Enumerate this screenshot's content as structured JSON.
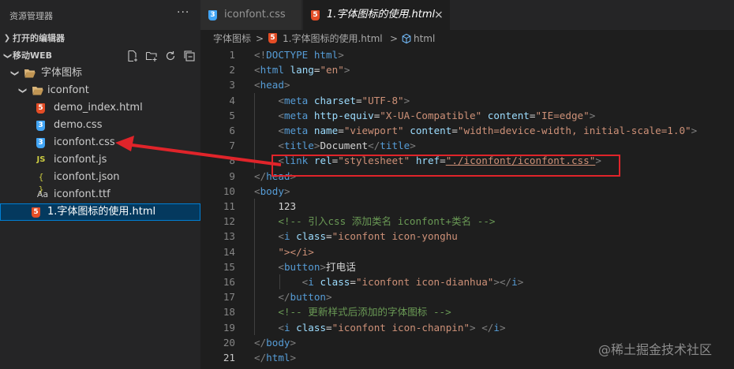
{
  "sidebar": {
    "title": "资源管理器",
    "more_icon": "ellipsis-icon",
    "open_editors_label": "打开的编辑器",
    "workspace_label": "移动WEB",
    "actions": [
      "new-file-icon",
      "new-folder-icon",
      "refresh-icon",
      "collapse-all-icon"
    ],
    "tree": [
      {
        "label": "字体图标",
        "type": "folder",
        "icon": "folder-open-icon"
      },
      {
        "label": "iconfont",
        "type": "folder",
        "icon": "folder-open-icon"
      },
      {
        "label": "demo_index.html",
        "type": "file",
        "icon": "html5-icon",
        "icon_text": "5"
      },
      {
        "label": "demo.css",
        "type": "file",
        "icon": "css3-icon",
        "icon_text": "3"
      },
      {
        "label": "iconfont.css",
        "type": "file",
        "icon": "css3-icon",
        "icon_text": "3"
      },
      {
        "label": "iconfont.js",
        "type": "file",
        "icon": "js-icon",
        "icon_text": "JS"
      },
      {
        "label": "iconfont.json",
        "type": "file",
        "icon": "json-braces-icon",
        "icon_text": "{ }"
      },
      {
        "label": "iconfont.ttf",
        "type": "file",
        "icon": "font-icon",
        "icon_text": "Aa"
      },
      {
        "label": "1.字体图标的使用.html",
        "type": "file",
        "icon": "html5-icon",
        "icon_text": "5",
        "selected": true
      }
    ]
  },
  "tabs": [
    {
      "label": "iconfont.css",
      "icon": "css3-icon",
      "active": false
    },
    {
      "label": "1.字体图标的使用.html",
      "icon": "html5-icon",
      "active": true,
      "close": "×"
    }
  ],
  "breadcrumb": {
    "folder": "字体图标",
    "sep": ">",
    "file": "1.字体图标的使用.html",
    "symbol": "html"
  },
  "editor": {
    "current_line": 21,
    "line_numbers": [
      "1",
      "2",
      "3",
      "4",
      "5",
      "6",
      "7",
      "8",
      "9",
      "10",
      "11",
      "12",
      "13",
      "14",
      "15",
      "16",
      "17",
      "18",
      "19",
      "20",
      "21"
    ],
    "lines": [
      "<!DOCTYPE html>",
      "<html lang=\"en\">",
      "<head>",
      "    <meta charset=\"UTF-8\">",
      "    <meta http-equiv=\"X-UA-Compatible\" content=\"IE=edge\">",
      "    <meta name=\"viewport\" content=\"width=device-width, initial-scale=1.0\">",
      "    <title>Document</title>",
      "    <link rel=\"stylesheet\" href=\"./iconfont/iconfont.css\">",
      "</head>",
      "<body>",
      "    123",
      "    <!-- 引入css 添加类名 iconfont+类名 -->",
      "    <i class=\"iconfont icon-yonghu",
      "    \"></i>",
      "    <button>打电话",
      "        <i class=\"iconfont icon-dianhua\"></i>",
      "    </button>",
      "    <!-- 更新样式后添加的字体图标 -->",
      "    <i class=\"iconfont icon-chanpin\"> </i>",
      "</body>",
      "</html>"
    ]
  },
  "annotation": {
    "color": "#e0242a"
  },
  "watermark": "@稀土掘金技术社区",
  "colors": {
    "html5": "#e44d26",
    "css3": "#42a5f5",
    "js": "#cbcb41",
    "folder": "#dcb67a",
    "selected_bg": "#04395e"
  }
}
